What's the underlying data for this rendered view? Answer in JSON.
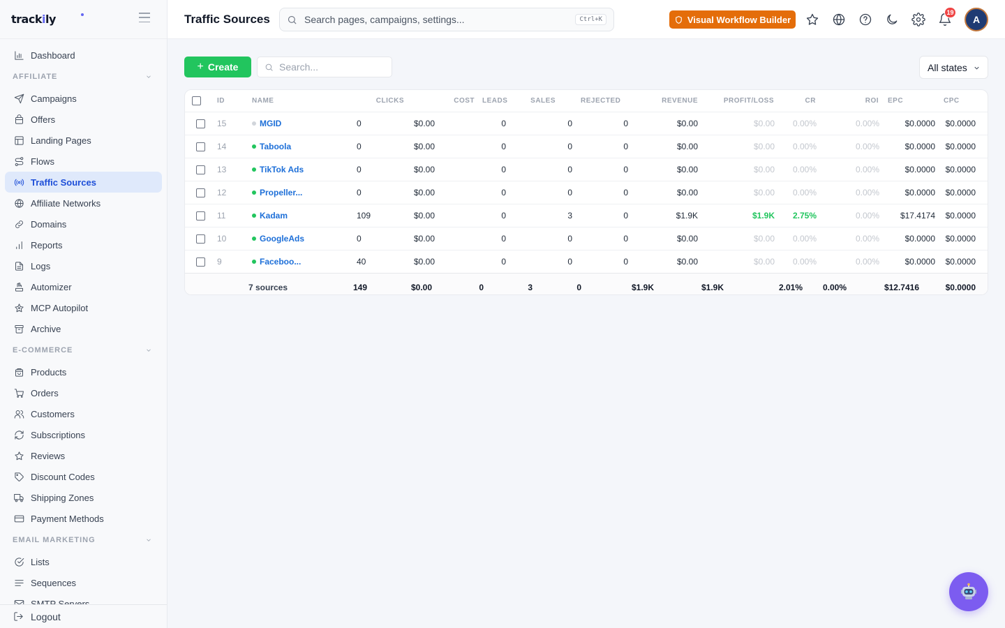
{
  "brand": {
    "name": "trackily"
  },
  "sidebar": {
    "top_items": [
      {
        "label": "Dashboard",
        "icon": "chart-bar-icon"
      }
    ],
    "sections": [
      {
        "label": "AFFILIATE",
        "items": [
          {
            "label": "Campaigns",
            "icon": "send-icon"
          },
          {
            "label": "Offers",
            "icon": "bag-icon"
          },
          {
            "label": "Landing Pages",
            "icon": "layout-icon"
          },
          {
            "label": "Flows",
            "icon": "route-icon"
          },
          {
            "label": "Traffic Sources",
            "icon": "radio-icon",
            "active": true
          },
          {
            "label": "Affiliate Networks",
            "icon": "globe-icon"
          },
          {
            "label": "Domains",
            "icon": "link-icon"
          },
          {
            "label": "Reports",
            "icon": "bar-chart-icon"
          },
          {
            "label": "Logs",
            "icon": "file-text-icon"
          },
          {
            "label": "Automizer",
            "icon": "hand-icon"
          },
          {
            "label": "MCP Autopilot",
            "icon": "sparkle-star-icon"
          },
          {
            "label": "Archive",
            "icon": "archive-icon"
          }
        ]
      },
      {
        "label": "E-COMMERCE",
        "items": [
          {
            "label": "Products",
            "icon": "package-icon"
          },
          {
            "label": "Orders",
            "icon": "cart-icon"
          },
          {
            "label": "Customers",
            "icon": "users-icon"
          },
          {
            "label": "Subscriptions",
            "icon": "refresh-icon"
          },
          {
            "label": "Reviews",
            "icon": "star-icon"
          },
          {
            "label": "Discount Codes",
            "icon": "tag-icon"
          },
          {
            "label": "Shipping Zones",
            "icon": "truck-icon"
          },
          {
            "label": "Payment Methods",
            "icon": "credit-card-icon"
          }
        ]
      },
      {
        "label": "EMAIL MARKETING",
        "items": [
          {
            "label": "Lists",
            "icon": "check-circle-icon"
          },
          {
            "label": "Sequences",
            "icon": "lines-icon"
          },
          {
            "label": "SMTP Servers",
            "icon": "mail-icon"
          }
        ]
      }
    ],
    "logout_label": "Logout"
  },
  "header": {
    "title": "Traffic Sources",
    "search_placeholder": "Search pages, campaigns, settings...",
    "search_shortcut": "Ctrl+K",
    "workflow_label": "Visual Workflow Builder",
    "notification_count": "19",
    "avatar_initial": "A"
  },
  "toolbar": {
    "create_label": "Create",
    "search_placeholder": "Search...",
    "state_filter": "All states"
  },
  "table": {
    "columns": {
      "id": "ID",
      "name": "NAME",
      "clicks": "CLICKS",
      "cost": "COST",
      "leads": "LEADS",
      "sales": "SALES",
      "rejected": "REJECTED",
      "revenue": "REVENUE",
      "profit": "PROFIT/LOSS",
      "cr": "CR",
      "roi": "ROI",
      "epc": "EPC",
      "cpc": "CPC"
    },
    "rows": [
      {
        "id": "15",
        "name": "MGID",
        "status": "inactive",
        "clicks": "0",
        "cost": "$0.00",
        "leads": "0",
        "sales": "0",
        "rejected": "0",
        "revenue": "$0.00",
        "profit": "$0.00",
        "cr": "0.00%",
        "roi": "0.00%",
        "epc": "$0.0000",
        "cpc": "$0.0000"
      },
      {
        "id": "14",
        "name": "Taboola",
        "status": "active",
        "clicks": "0",
        "cost": "$0.00",
        "leads": "0",
        "sales": "0",
        "rejected": "0",
        "revenue": "$0.00",
        "profit": "$0.00",
        "cr": "0.00%",
        "roi": "0.00%",
        "epc": "$0.0000",
        "cpc": "$0.0000"
      },
      {
        "id": "13",
        "name": "TikTok Ads",
        "status": "active",
        "clicks": "0",
        "cost": "$0.00",
        "leads": "0",
        "sales": "0",
        "rejected": "0",
        "revenue": "$0.00",
        "profit": "$0.00",
        "cr": "0.00%",
        "roi": "0.00%",
        "epc": "$0.0000",
        "cpc": "$0.0000"
      },
      {
        "id": "12",
        "name": "Propeller...",
        "status": "active",
        "clicks": "0",
        "cost": "$0.00",
        "leads": "0",
        "sales": "0",
        "rejected": "0",
        "revenue": "$0.00",
        "profit": "$0.00",
        "cr": "0.00%",
        "roi": "0.00%",
        "epc": "$0.0000",
        "cpc": "$0.0000"
      },
      {
        "id": "11",
        "name": "Kadam",
        "status": "active",
        "clicks": "109",
        "cost": "$0.00",
        "leads": "0",
        "sales": "3",
        "rejected": "0",
        "revenue": "$1.9K",
        "profit": "$1.9K",
        "cr": "2.75%",
        "roi": "0.00%",
        "epc": "$17.4174",
        "cpc": "$0.0000",
        "highlight": true
      },
      {
        "id": "10",
        "name": "GoogleAds",
        "status": "active",
        "clicks": "0",
        "cost": "$0.00",
        "leads": "0",
        "sales": "0",
        "rejected": "0",
        "revenue": "$0.00",
        "profit": "$0.00",
        "cr": "0.00%",
        "roi": "0.00%",
        "epc": "$0.0000",
        "cpc": "$0.0000"
      },
      {
        "id": "9",
        "name": "Faceboo...",
        "status": "active",
        "clicks": "40",
        "cost": "$0.00",
        "leads": "0",
        "sales": "0",
        "rejected": "0",
        "revenue": "$0.00",
        "profit": "$0.00",
        "cr": "0.00%",
        "roi": "0.00%",
        "epc": "$0.0000",
        "cpc": "$0.0000"
      }
    ],
    "totals": {
      "label": "7 sources",
      "clicks": "149",
      "cost": "$0.00",
      "leads": "0",
      "sales": "3",
      "rejected": "0",
      "revenue": "$1.9K",
      "profit": "$1.9K",
      "cr": "2.01%",
      "roi": "0.00%",
      "epc": "$12.7416",
      "cpc": "$0.0000"
    }
  },
  "colors": {
    "accent": "#1d6fd8",
    "success": "#22c55e",
    "warning": "#e46d0a",
    "inactive_dot": "#d1d5db",
    "bot": "#7c5cf0"
  }
}
